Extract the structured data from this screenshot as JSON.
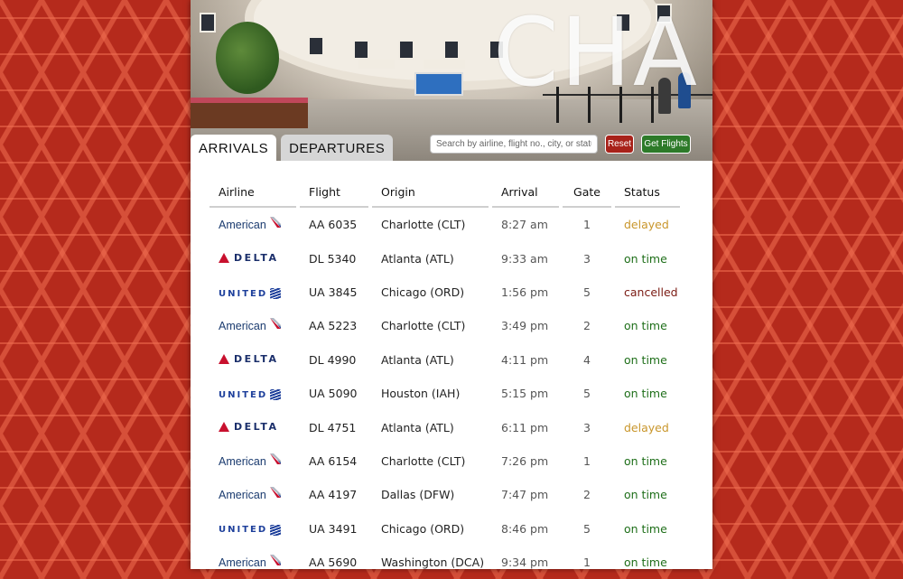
{
  "hero": {
    "airport_code": "CHA"
  },
  "tabs": [
    {
      "label": "ARRIVALS",
      "active": true
    },
    {
      "label": "DEPARTURES",
      "active": false
    }
  ],
  "search": {
    "placeholder": "Search by airline, flight no., city, or status",
    "value": ""
  },
  "buttons": {
    "reset": "Reset",
    "get_flights": "Get Flights"
  },
  "colors": {
    "reset": "#a8221a",
    "get_flights": "#2d7a29",
    "delayed": "#c9962b",
    "on_time": "#1f6f1a",
    "cancelled": "#7a1a12"
  },
  "table": {
    "headers": {
      "airline": "Airline",
      "flight": "Flight",
      "origin": "Origin",
      "arrival": "Arrival",
      "gate": "Gate",
      "status": "Status"
    },
    "rows": [
      {
        "airline": "American",
        "flight": "AA 6035",
        "origin": "Charlotte (CLT)",
        "arrival": "8:27 am",
        "gate": "1",
        "status": "delayed"
      },
      {
        "airline": "DELTA",
        "flight": "DL 5340",
        "origin": "Atlanta (ATL)",
        "arrival": "9:33 am",
        "gate": "3",
        "status": "on time"
      },
      {
        "airline": "UNITED",
        "flight": "UA 3845",
        "origin": "Chicago (ORD)",
        "arrival": "1:56 pm",
        "gate": "5",
        "status": "cancelled"
      },
      {
        "airline": "American",
        "flight": "AA 5223",
        "origin": "Charlotte (CLT)",
        "arrival": "3:49 pm",
        "gate": "2",
        "status": "on time"
      },
      {
        "airline": "DELTA",
        "flight": "DL 4990",
        "origin": "Atlanta (ATL)",
        "arrival": "4:11 pm",
        "gate": "4",
        "status": "on time"
      },
      {
        "airline": "UNITED",
        "flight": "UA 5090",
        "origin": "Houston (IAH)",
        "arrival": "5:15 pm",
        "gate": "5",
        "status": "on time"
      },
      {
        "airline": "DELTA",
        "flight": "DL 4751",
        "origin": "Atlanta (ATL)",
        "arrival": "6:11 pm",
        "gate": "3",
        "status": "delayed"
      },
      {
        "airline": "American",
        "flight": "AA 6154",
        "origin": "Charlotte (CLT)",
        "arrival": "7:26 pm",
        "gate": "1",
        "status": "on time"
      },
      {
        "airline": "American",
        "flight": "AA 4197",
        "origin": "Dallas (DFW)",
        "arrival": "7:47 pm",
        "gate": "2",
        "status": "on time"
      },
      {
        "airline": "UNITED",
        "flight": "UA 3491",
        "origin": "Chicago (ORD)",
        "arrival": "8:46 pm",
        "gate": "5",
        "status": "on time"
      },
      {
        "airline": "American",
        "flight": "AA 5690",
        "origin": "Washington (DCA)",
        "arrival": "9:34 pm",
        "gate": "1",
        "status": "on time"
      }
    ]
  }
}
